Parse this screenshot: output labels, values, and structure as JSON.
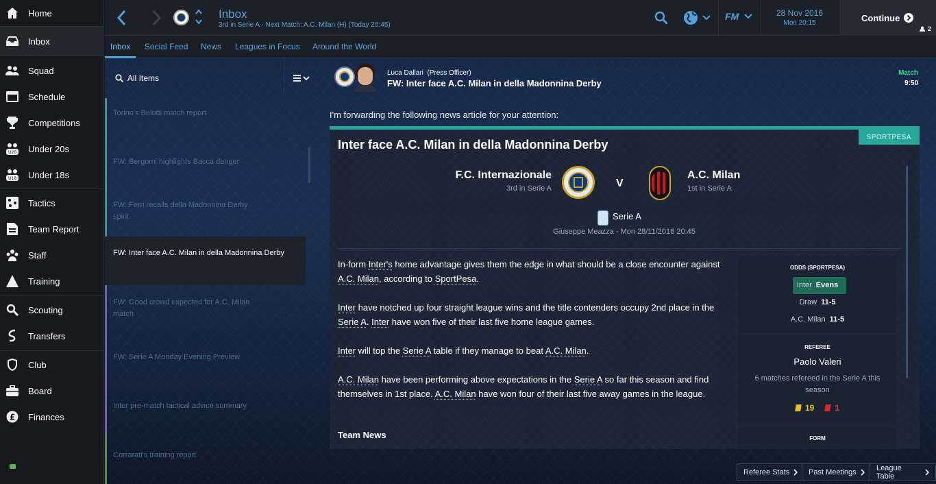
{
  "sidebar": {
    "items": [
      {
        "label": "Home",
        "icon": "home-icon"
      },
      {
        "label": "Inbox",
        "icon": "inbox-icon"
      },
      {
        "label": "Squad",
        "icon": "squad-icon"
      },
      {
        "label": "Schedule",
        "icon": "calendar-icon"
      },
      {
        "label": "Competitions",
        "icon": "trophy-icon"
      },
      {
        "label": "Under 20s",
        "icon": "u20-icon"
      },
      {
        "label": "Under 18s",
        "icon": "u18-icon"
      },
      {
        "label": "Tactics",
        "icon": "tactics-icon"
      },
      {
        "label": "Team Report",
        "icon": "report-icon"
      },
      {
        "label": "Staff",
        "icon": "staff-icon"
      },
      {
        "label": "Training",
        "icon": "training-icon"
      },
      {
        "label": "Scouting",
        "icon": "search-icon"
      },
      {
        "label": "Transfers",
        "icon": "transfers-icon"
      },
      {
        "label": "Club",
        "icon": "shield-icon"
      },
      {
        "label": "Board",
        "icon": "briefcase-icon"
      },
      {
        "label": "Finances",
        "icon": "pound-icon"
      }
    ]
  },
  "header": {
    "title": "Inbox",
    "subtitle": "3rd in Serie A - Next Match: A.C. Milan (H) (Today 20:45)",
    "date": "28 Nov 2016",
    "time": "Mon 20:15",
    "continue_label": "Continue",
    "user_count": "2",
    "fm_label": "FM"
  },
  "tabs": [
    "Inbox",
    "Social Feed",
    "News",
    "Leagues in Focus",
    "Around the World"
  ],
  "list": {
    "filter_label": "All Items",
    "messages": [
      "Torino's Belotti match report",
      "FW: Bergomi highlights Bacca danger",
      "FW: Ferri recalls della Madonnina Derby spirit",
      "FW: Inter face A.C. Milan in della Madonnina Derby",
      "FW: Good crowd expected for A.C. Milan match",
      "FW: Serie A Monday Evening Preview",
      "Inter pre-match tactical advice summary",
      "Corrarati's training report"
    ]
  },
  "message": {
    "sender": "Luca Dallari",
    "sender_role": "(Press Officer)",
    "subject": "FW: Inter face A.C. Milan in della Madonnina Derby",
    "tag": "Match",
    "tag_time": "9:50",
    "intro": "I'm forwarding the following news article for your attention:"
  },
  "article": {
    "source": "SPORTPESA",
    "title": "Inter face A.C. Milan in della Madonnina Derby",
    "home_team": "F.C. Internazionale",
    "home_pos": "3rd in Serie A",
    "vs": "V",
    "away_team": "A.C. Milan",
    "away_pos": "1st in Serie A",
    "competition": "Serie A",
    "venue": "Giuseppe Meazza - Mon 28/11/2016 20:45",
    "p1a": "In-form ",
    "p1b": "Inter's",
    "p1c": " home advantage gives them the edge in what should be a close encounter against ",
    "p1d": "A.C. Milan",
    "p1e": ", according to ",
    "p1f": "SportPesa",
    "p1g": ".",
    "p2a": "Inter",
    "p2b": " have notched up four straight league wins and the title contenders occupy 2nd place in the ",
    "p2c": "Serie A",
    "p2d": ". ",
    "p2e": "Inter",
    "p2f": " have won five of their last five home league games.",
    "p3a": "Inter",
    "p3b": " will top the ",
    "p3c": "Serie A",
    "p3d": " table if they manage to beat ",
    "p3e": "A.C. Milan",
    "p3f": ".",
    "p4a": "A.C. Milan",
    "p4b": " have been performing above expectations in the ",
    "p4c": "Serie A",
    "p4d": " so far this season and find themselves in 1st place. ",
    "p4e": "A.C. Milan",
    "p4f": " have won four of their last five away games in the league.",
    "team_news": "Team News"
  },
  "odds": {
    "title": "ODDS (SPORTPESA)",
    "rows": [
      {
        "team": "Inter",
        "value": "Evens"
      },
      {
        "team": "Draw",
        "value": "11-5"
      },
      {
        "team": "A.C. Milan",
        "value": "11-5"
      }
    ]
  },
  "referee": {
    "title": "REFEREE",
    "name": "Paolo Valeri",
    "desc": "6 matches refereed in the Serie A this season",
    "yellow": "19",
    "red": "1"
  },
  "form_title": "FORM",
  "bottom_buttons": [
    "Referee Stats",
    "Past Meetings",
    "League Table"
  ],
  "colors": {
    "accent": "#28a89a",
    "link": "#5aa6d6",
    "highlight": "#1f6b55"
  }
}
